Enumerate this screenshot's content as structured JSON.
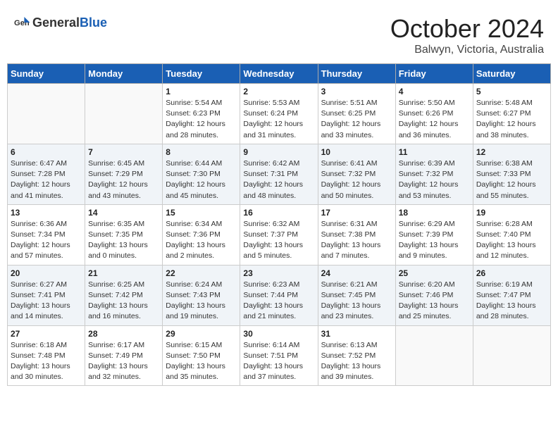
{
  "header": {
    "logo_general": "General",
    "logo_blue": "Blue",
    "month": "October 2024",
    "location": "Balwyn, Victoria, Australia"
  },
  "days_of_week": [
    "Sunday",
    "Monday",
    "Tuesday",
    "Wednesday",
    "Thursday",
    "Friday",
    "Saturday"
  ],
  "weeks": [
    [
      {
        "day": "",
        "sunrise": "",
        "sunset": "",
        "daylight": ""
      },
      {
        "day": "",
        "sunrise": "",
        "sunset": "",
        "daylight": ""
      },
      {
        "day": "1",
        "sunrise": "Sunrise: 5:54 AM",
        "sunset": "Sunset: 6:23 PM",
        "daylight": "Daylight: 12 hours and 28 minutes."
      },
      {
        "day": "2",
        "sunrise": "Sunrise: 5:53 AM",
        "sunset": "Sunset: 6:24 PM",
        "daylight": "Daylight: 12 hours and 31 minutes."
      },
      {
        "day": "3",
        "sunrise": "Sunrise: 5:51 AM",
        "sunset": "Sunset: 6:25 PM",
        "daylight": "Daylight: 12 hours and 33 minutes."
      },
      {
        "day": "4",
        "sunrise": "Sunrise: 5:50 AM",
        "sunset": "Sunset: 6:26 PM",
        "daylight": "Daylight: 12 hours and 36 minutes."
      },
      {
        "day": "5",
        "sunrise": "Sunrise: 5:48 AM",
        "sunset": "Sunset: 6:27 PM",
        "daylight": "Daylight: 12 hours and 38 minutes."
      }
    ],
    [
      {
        "day": "6",
        "sunrise": "Sunrise: 6:47 AM",
        "sunset": "Sunset: 7:28 PM",
        "daylight": "Daylight: 12 hours and 41 minutes."
      },
      {
        "day": "7",
        "sunrise": "Sunrise: 6:45 AM",
        "sunset": "Sunset: 7:29 PM",
        "daylight": "Daylight: 12 hours and 43 minutes."
      },
      {
        "day": "8",
        "sunrise": "Sunrise: 6:44 AM",
        "sunset": "Sunset: 7:30 PM",
        "daylight": "Daylight: 12 hours and 45 minutes."
      },
      {
        "day": "9",
        "sunrise": "Sunrise: 6:42 AM",
        "sunset": "Sunset: 7:31 PM",
        "daylight": "Daylight: 12 hours and 48 minutes."
      },
      {
        "day": "10",
        "sunrise": "Sunrise: 6:41 AM",
        "sunset": "Sunset: 7:32 PM",
        "daylight": "Daylight: 12 hours and 50 minutes."
      },
      {
        "day": "11",
        "sunrise": "Sunrise: 6:39 AM",
        "sunset": "Sunset: 7:32 PM",
        "daylight": "Daylight: 12 hours and 53 minutes."
      },
      {
        "day": "12",
        "sunrise": "Sunrise: 6:38 AM",
        "sunset": "Sunset: 7:33 PM",
        "daylight": "Daylight: 12 hours and 55 minutes."
      }
    ],
    [
      {
        "day": "13",
        "sunrise": "Sunrise: 6:36 AM",
        "sunset": "Sunset: 7:34 PM",
        "daylight": "Daylight: 12 hours and 57 minutes."
      },
      {
        "day": "14",
        "sunrise": "Sunrise: 6:35 AM",
        "sunset": "Sunset: 7:35 PM",
        "daylight": "Daylight: 13 hours and 0 minutes."
      },
      {
        "day": "15",
        "sunrise": "Sunrise: 6:34 AM",
        "sunset": "Sunset: 7:36 PM",
        "daylight": "Daylight: 13 hours and 2 minutes."
      },
      {
        "day": "16",
        "sunrise": "Sunrise: 6:32 AM",
        "sunset": "Sunset: 7:37 PM",
        "daylight": "Daylight: 13 hours and 5 minutes."
      },
      {
        "day": "17",
        "sunrise": "Sunrise: 6:31 AM",
        "sunset": "Sunset: 7:38 PM",
        "daylight": "Daylight: 13 hours and 7 minutes."
      },
      {
        "day": "18",
        "sunrise": "Sunrise: 6:29 AM",
        "sunset": "Sunset: 7:39 PM",
        "daylight": "Daylight: 13 hours and 9 minutes."
      },
      {
        "day": "19",
        "sunrise": "Sunrise: 6:28 AM",
        "sunset": "Sunset: 7:40 PM",
        "daylight": "Daylight: 13 hours and 12 minutes."
      }
    ],
    [
      {
        "day": "20",
        "sunrise": "Sunrise: 6:27 AM",
        "sunset": "Sunset: 7:41 PM",
        "daylight": "Daylight: 13 hours and 14 minutes."
      },
      {
        "day": "21",
        "sunrise": "Sunrise: 6:25 AM",
        "sunset": "Sunset: 7:42 PM",
        "daylight": "Daylight: 13 hours and 16 minutes."
      },
      {
        "day": "22",
        "sunrise": "Sunrise: 6:24 AM",
        "sunset": "Sunset: 7:43 PM",
        "daylight": "Daylight: 13 hours and 19 minutes."
      },
      {
        "day": "23",
        "sunrise": "Sunrise: 6:23 AM",
        "sunset": "Sunset: 7:44 PM",
        "daylight": "Daylight: 13 hours and 21 minutes."
      },
      {
        "day": "24",
        "sunrise": "Sunrise: 6:21 AM",
        "sunset": "Sunset: 7:45 PM",
        "daylight": "Daylight: 13 hours and 23 minutes."
      },
      {
        "day": "25",
        "sunrise": "Sunrise: 6:20 AM",
        "sunset": "Sunset: 7:46 PM",
        "daylight": "Daylight: 13 hours and 25 minutes."
      },
      {
        "day": "26",
        "sunrise": "Sunrise: 6:19 AM",
        "sunset": "Sunset: 7:47 PM",
        "daylight": "Daylight: 13 hours and 28 minutes."
      }
    ],
    [
      {
        "day": "27",
        "sunrise": "Sunrise: 6:18 AM",
        "sunset": "Sunset: 7:48 PM",
        "daylight": "Daylight: 13 hours and 30 minutes."
      },
      {
        "day": "28",
        "sunrise": "Sunrise: 6:17 AM",
        "sunset": "Sunset: 7:49 PM",
        "daylight": "Daylight: 13 hours and 32 minutes."
      },
      {
        "day": "29",
        "sunrise": "Sunrise: 6:15 AM",
        "sunset": "Sunset: 7:50 PM",
        "daylight": "Daylight: 13 hours and 35 minutes."
      },
      {
        "day": "30",
        "sunrise": "Sunrise: 6:14 AM",
        "sunset": "Sunset: 7:51 PM",
        "daylight": "Daylight: 13 hours and 37 minutes."
      },
      {
        "day": "31",
        "sunrise": "Sunrise: 6:13 AM",
        "sunset": "Sunset: 7:52 PM",
        "daylight": "Daylight: 13 hours and 39 minutes."
      },
      {
        "day": "",
        "sunrise": "",
        "sunset": "",
        "daylight": ""
      },
      {
        "day": "",
        "sunrise": "",
        "sunset": "",
        "daylight": ""
      }
    ]
  ]
}
